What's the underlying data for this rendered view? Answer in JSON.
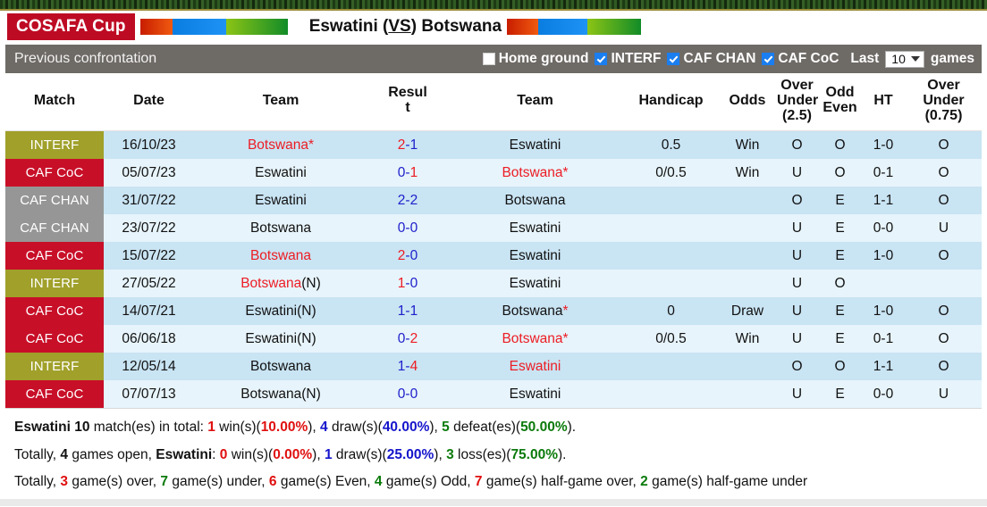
{
  "header": {
    "cup_badge": "COSAFA Cup",
    "match_title_part1": "Eswatini (",
    "match_title_vs": "VS",
    "match_title_part2": ") Botswana"
  },
  "controls": {
    "section_label": "Previous confrontation",
    "home_ground_label": "Home ground",
    "home_ground_checked": false,
    "filters": [
      {
        "label": "INTERF",
        "checked": true
      },
      {
        "label": "CAF CHAN",
        "checked": true
      },
      {
        "label": "CAF CoC",
        "checked": true
      }
    ],
    "last_label": "Last",
    "last_value": "10",
    "games_label": "games"
  },
  "table": {
    "columns": [
      "Match",
      "Date",
      "Team",
      "Resul\nt",
      "Team",
      "Handicap",
      "Odds",
      "Over\nUnder\n(2.5)",
      "Odd\nEven",
      "HT",
      "Over\nUnder\n(0.75)"
    ],
    "column_labels": {
      "match": "Match",
      "date": "Date",
      "team_home": "Team",
      "result_l1": "Resul",
      "result_l2": "t",
      "team_away": "Team",
      "handicap": "Handicap",
      "odds": "Odds",
      "ou25_l1": "Over",
      "ou25_l2": "Under",
      "ou25_l3": "(2.5)",
      "oddeven_l1": "Odd",
      "oddeven_l2": "Even",
      "ht": "HT",
      "ou075_l1": "Over",
      "ou075_l2": "Under",
      "ou075_l3": "(0.75)"
    },
    "rows": [
      {
        "comp": "INTERF",
        "comp_class": "b-INTERF",
        "date": "16/10/23",
        "home": "Botswana*",
        "home_color": "red",
        "home_suffix": "",
        "home_suffix_color": "black",
        "score_a": "2",
        "score_a_color": "red",
        "score_b": "-1",
        "score_b_color": "blue",
        "away": "Eswatini",
        "away_color": "black",
        "away_suffix": "",
        "away_suffix_color": "black",
        "handicap": "0.5",
        "odds": "Win",
        "odds_color": "red",
        "ou25": "O",
        "ou25_color": "red",
        "oddeven": "O",
        "oddeven_color": "green",
        "ht": "1-0",
        "ou075": "O",
        "ou075_color": "red"
      },
      {
        "comp": "CAF CoC",
        "comp_class": "b-CAFCoC",
        "date": "05/07/23",
        "home": "Eswatini",
        "home_color": "black",
        "home_suffix": "",
        "home_suffix_color": "black",
        "score_a": "0-",
        "score_a_color": "blue",
        "score_b": "1",
        "score_b_color": "red",
        "away": "Botswana*",
        "away_color": "red",
        "away_suffix": "",
        "away_suffix_color": "black",
        "handicap": "0/0.5",
        "odds": "Win",
        "odds_color": "red",
        "ou25": "U",
        "ou25_color": "green",
        "oddeven": "O",
        "oddeven_color": "green",
        "ht": "0-1",
        "ou075": "O",
        "ou075_color": "red"
      },
      {
        "comp": "CAF CHAN",
        "comp_class": "b-CAFCHAN",
        "date": "31/07/22",
        "home": "Eswatini",
        "home_color": "black",
        "home_suffix": "",
        "home_suffix_color": "black",
        "score_a": "2-2",
        "score_a_color": "blue",
        "score_b": "",
        "score_b_color": "blue",
        "away": "Botswana",
        "away_color": "black",
        "away_suffix": "",
        "away_suffix_color": "black",
        "handicap": "",
        "odds": "",
        "odds_color": "red",
        "ou25": "O",
        "ou25_color": "red",
        "oddeven": "E",
        "oddeven_color": "red",
        "ht": "1-1",
        "ou075": "O",
        "ou075_color": "red"
      },
      {
        "comp": "CAF CHAN",
        "comp_class": "b-CAFCHAN",
        "date": "23/07/22",
        "home": "Botswana",
        "home_color": "black",
        "home_suffix": "",
        "home_suffix_color": "black",
        "score_a": "0-0",
        "score_a_color": "blue",
        "score_b": "",
        "score_b_color": "blue",
        "away": "Eswatini",
        "away_color": "black",
        "away_suffix": "",
        "away_suffix_color": "black",
        "handicap": "",
        "odds": "",
        "odds_color": "red",
        "ou25": "U",
        "ou25_color": "green",
        "oddeven": "E",
        "oddeven_color": "red",
        "ht": "0-0",
        "ou075": "U",
        "ou075_color": "green"
      },
      {
        "comp": "CAF CoC",
        "comp_class": "b-CAFCoC",
        "date": "15/07/22",
        "home": "Botswana",
        "home_color": "red",
        "home_suffix": "",
        "home_suffix_color": "black",
        "score_a": "2",
        "score_a_color": "red",
        "score_b": "-0",
        "score_b_color": "blue",
        "away": "Eswatini",
        "away_color": "black",
        "away_suffix": "",
        "away_suffix_color": "black",
        "handicap": "",
        "odds": "",
        "odds_color": "red",
        "ou25": "U",
        "ou25_color": "green",
        "oddeven": "E",
        "oddeven_color": "red",
        "ht": "1-0",
        "ou075": "O",
        "ou075_color": "red"
      },
      {
        "comp": "INTERF",
        "comp_class": "b-INTERF",
        "date": "27/05/22",
        "home": "Botswana",
        "home_color": "red",
        "home_suffix": "(N)",
        "home_suffix_color": "black",
        "score_a": "1",
        "score_a_color": "red",
        "score_b": "-0",
        "score_b_color": "blue",
        "away": "Eswatini",
        "away_color": "black",
        "away_suffix": "",
        "away_suffix_color": "black",
        "handicap": "",
        "odds": "",
        "odds_color": "red",
        "ou25": "U",
        "ou25_color": "green",
        "oddeven": "O",
        "oddeven_color": "green",
        "ht": "",
        "ou075": "",
        "ou075_color": "red"
      },
      {
        "comp": "CAF CoC",
        "comp_class": "b-CAFCoC",
        "date": "14/07/21",
        "home": "Eswatini",
        "home_color": "black",
        "home_suffix": "(N)",
        "home_suffix_color": "black",
        "score_a": "1-1",
        "score_a_color": "blue",
        "score_b": "",
        "score_b_color": "blue",
        "away": "Botswana",
        "away_color": "black",
        "away_suffix": "*",
        "away_suffix_color": "red",
        "handicap": "0",
        "odds": "Draw",
        "odds_color": "blue",
        "ou25": "U",
        "ou25_color": "green",
        "oddeven": "E",
        "oddeven_color": "red",
        "ht": "1-0",
        "ou075": "O",
        "ou075_color": "red"
      },
      {
        "comp": "CAF CoC",
        "comp_class": "b-CAFCoC",
        "date": "06/06/18",
        "home": "Eswatini",
        "home_color": "black",
        "home_suffix": "(N)",
        "home_suffix_color": "black",
        "score_a": "0-",
        "score_a_color": "blue",
        "score_b": "2",
        "score_b_color": "red",
        "away": "Botswana*",
        "away_color": "red",
        "away_suffix": "",
        "away_suffix_color": "red",
        "handicap": "0/0.5",
        "odds": "Win",
        "odds_color": "red",
        "ou25": "U",
        "ou25_color": "green",
        "oddeven": "E",
        "oddeven_color": "red",
        "ht": "0-1",
        "ou075": "O",
        "ou075_color": "red"
      },
      {
        "comp": "INTERF",
        "comp_class": "b-INTERF",
        "date": "12/05/14",
        "home": "Botswana",
        "home_color": "black",
        "home_suffix": "",
        "home_suffix_color": "black",
        "score_a": "1-",
        "score_a_color": "blue",
        "score_b": "4",
        "score_b_color": "red",
        "away": "Eswatini",
        "away_color": "red",
        "away_suffix": "",
        "away_suffix_color": "black",
        "handicap": "",
        "odds": "",
        "odds_color": "red",
        "ou25": "O",
        "ou25_color": "red",
        "oddeven": "O",
        "oddeven_color": "green",
        "ht": "1-1",
        "ou075": "O",
        "ou075_color": "red"
      },
      {
        "comp": "CAF CoC",
        "comp_class": "b-CAFCoC",
        "date": "07/07/13",
        "home": "Botswana",
        "home_color": "black",
        "home_suffix": "(N)",
        "home_suffix_color": "black",
        "score_a": "0-0",
        "score_a_color": "blue",
        "score_b": "",
        "score_b_color": "blue",
        "away": "Eswatini",
        "away_color": "black",
        "away_suffix": "",
        "away_suffix_color": "black",
        "handicap": "",
        "odds": "",
        "odds_color": "red",
        "ou25": "U",
        "ou25_color": "green",
        "oddeven": "E",
        "oddeven_color": "red",
        "ht": "0-0",
        "ou075": "U",
        "ou075_color": "green"
      }
    ]
  },
  "summary": {
    "line1": {
      "team": "Eswatini",
      "total": "10",
      "total_text": " match(es) in total: ",
      "wins": "1",
      "wins_text": " win(s)(",
      "wins_pct": "10.00%",
      "draws": "4",
      "draws_text": " draw(s)(",
      "draws_pct": "40.00%",
      "defeats": "5",
      "defeats_text": " defeat(es)(",
      "defeats_pct": "50.00%"
    },
    "line2": {
      "prefix": "Totally, ",
      "open": "4",
      "open_text": " games open, ",
      "team": "Eswatini",
      "colon": ": ",
      "wins": "0",
      "wins_text": " win(s)(",
      "wins_pct": "0.00%",
      "draws": "1",
      "draws_text": " draw(s)(",
      "draws_pct": "25.00%",
      "losses": "3",
      "losses_text": " loss(es)(",
      "losses_pct": "75.00%"
    },
    "line3": {
      "prefix": "Totally, ",
      "over": "3",
      "over_text": " game(s) over, ",
      "under": "7",
      "under_text": " game(s) under, ",
      "even": "6",
      "even_text": " game(s) Even, ",
      "odd": "4",
      "odd_text": " game(s) Odd, ",
      "half_over": "7",
      "half_over_text": " game(s) half-game over, ",
      "half_under": "2",
      "half_under_text": " game(s) half-game under"
    }
  },
  "colors": {
    "badge_interf": "#A0A02B",
    "badge_cafcoc": "#C80F28",
    "badge_cafchan": "#969696",
    "cup_badge_bg": "#BE0B24",
    "ctrlbar_bg": "#6E6A66",
    "row_odd": "#C9E4F3",
    "row_even": "#E7F4FB",
    "accent_blue": "#1A7EF0"
  }
}
